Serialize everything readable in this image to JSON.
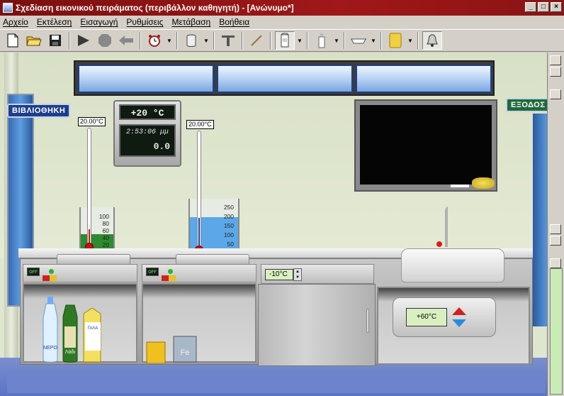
{
  "window": {
    "title": "Σχεδίαση εικονικού πειράματος (περιβάλλον καθηγητή) - [Ανώνυμο*]",
    "controls": [
      "_",
      "□",
      "×"
    ]
  },
  "menu": [
    "Αρχείο",
    "Εκτέλεση",
    "Εισαγωγή",
    "Ρυθμίσεις",
    "Μετάβαση",
    "Βοήθεια"
  ],
  "toolbar": {
    "icons": [
      "new-file",
      "open-folder",
      "save",
      "play",
      "stop",
      "back",
      "alarm-clock",
      "container",
      "stand",
      "glass-rod",
      "cup",
      "bottle",
      "dish",
      "sponge",
      "bell"
    ]
  },
  "room": {
    "sign_library": "ΒΙΒΛΙΟΘΗΚΗ",
    "sign_exit": "ΕΞΟΔΟΣ"
  },
  "display": {
    "temperature": "+20 °C",
    "time": "2:53:06 μμ",
    "value": "0.0"
  },
  "thermometer_left": {
    "label": "20.00°C",
    "level": 0.0
  },
  "thermometer_right": {
    "label": "20.00°C",
    "level": 0.0
  },
  "beaker_left": {
    "scale": [
      "100",
      "80",
      "60",
      "40",
      "20"
    ],
    "liquid_color": "#2e8b2e"
  },
  "beaker_right": {
    "scale": [
      "250",
      "200",
      "150",
      "100",
      "50"
    ],
    "liquid_color": "#5aa8e8"
  },
  "burner_left": {
    "switch": "OFF"
  },
  "burner_right": {
    "switch": "OFF"
  },
  "fridge": {
    "temperature": "-10°C"
  },
  "boiler": {
    "temperature": "+60°C"
  },
  "shelf_items": {
    "water_label": "ΝΕΡΟ",
    "oil_label": "Λάδι",
    "milk_label": "ΓΑΛΑ",
    "iron_label": "Fe"
  },
  "colors": {
    "title_bar": "#a01818",
    "lcd": "#d8f0c0",
    "sign_library": "#1c3e8c",
    "sign_exit": "#1f6a3a"
  }
}
